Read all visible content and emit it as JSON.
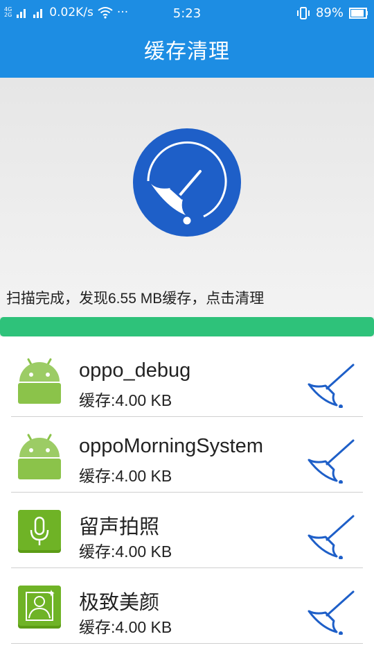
{
  "status_bar": {
    "network_type_1": "4G",
    "network_type_2": "2G",
    "speed": "0.02K/s",
    "more": "···",
    "time": "5:23",
    "battery": "89%"
  },
  "header": {
    "title": "缓存清理"
  },
  "scan": {
    "message": "扫描完成，发现6.55 MB缓存，点击清理",
    "progress": 1.0
  },
  "colors": {
    "primary": "#1d8de3",
    "broom_blue": "#1e5fc8",
    "progress_green": "#2ec27a"
  },
  "apps": [
    {
      "name": "oppo_debug",
      "size": "缓存:4.00 KB",
      "icon": "android-icon"
    },
    {
      "name": "oppoMorningSystem",
      "size": "缓存:4.00 KB",
      "icon": "android-icon"
    },
    {
      "name": "留声拍照",
      "size": "缓存:4.00 KB",
      "icon": "microphone-icon"
    },
    {
      "name": "极致美颜",
      "size": "缓存:4.00 KB",
      "icon": "portrait-icon"
    }
  ]
}
